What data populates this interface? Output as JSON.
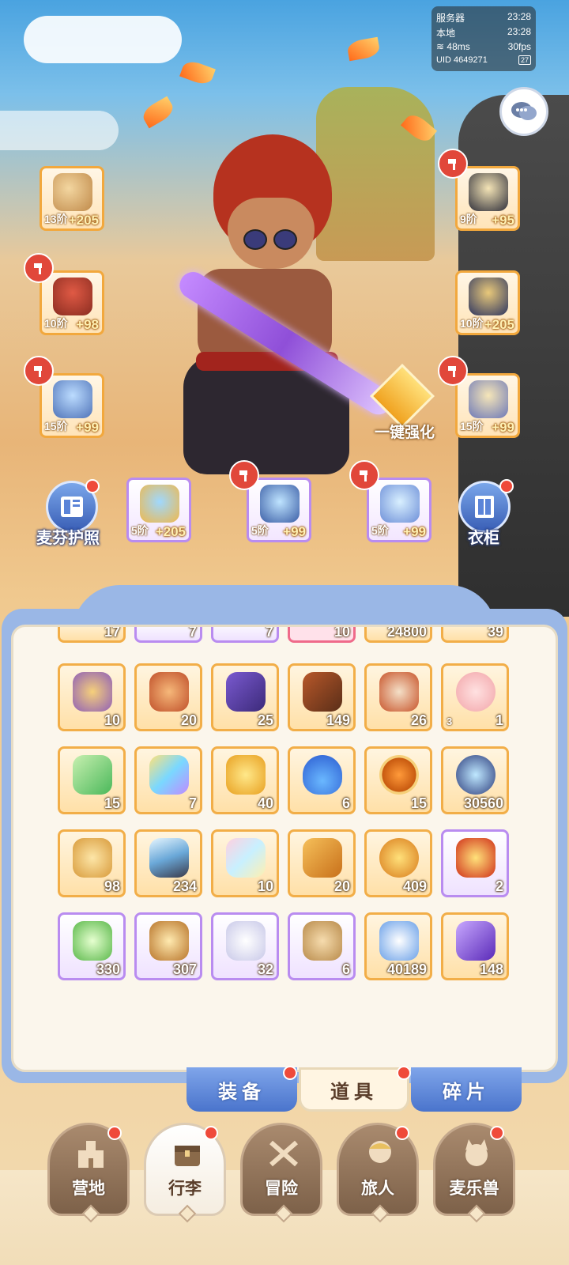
{
  "status": {
    "server_label": "服务器",
    "server_time": "23:28",
    "local_label": "本地",
    "local_time": "23:28",
    "ping": "48ms",
    "fps": "30fps",
    "uid": "UID 4649271",
    "battery": "27"
  },
  "equipment": {
    "left": [
      {
        "level": "13阶",
        "bonus": "+205",
        "icon": "bow-icon"
      },
      {
        "level": "10阶",
        "bonus": "+98",
        "icon": "armor-icon"
      },
      {
        "level": "15阶",
        "bonus": "+99",
        "icon": "pants-icon"
      }
    ],
    "right": [
      {
        "level": "9阶",
        "bonus": "+95",
        "icon": "helmet-icon"
      },
      {
        "level": "10阶",
        "bonus": "+205",
        "icon": "bracer-icon"
      },
      {
        "level": "15阶",
        "bonus": "+99",
        "icon": "boots-icon"
      }
    ],
    "accessories": [
      {
        "level": "5阶",
        "bonus": "+205",
        "icon": "ring-icon"
      },
      {
        "level": "5阶",
        "bonus": "+99",
        "icon": "necklace-icon"
      },
      {
        "level": "5阶",
        "bonus": "+99",
        "icon": "charm-icon"
      }
    ],
    "passport_label": "麦芬护照",
    "wardrobe_label": "衣柜",
    "quick_enhance_label": "一键强化"
  },
  "bag": {
    "partial_row": [
      "17",
      "7",
      "7",
      "10",
      "24800",
      "39"
    ],
    "rows": [
      [
        {
          "qty": "10",
          "icon": "guild-badge-icon"
        },
        {
          "qty": "20",
          "icon": "iron-icon"
        },
        {
          "qty": "25",
          "icon": "purple-ticket-icon"
        },
        {
          "qty": "149",
          "icon": "brown-ticket-icon"
        },
        {
          "qty": "26",
          "icon": "seed-bag-icon"
        },
        {
          "qty": "1",
          "tag": "3",
          "icon": "pig-icon"
        }
      ],
      [
        {
          "qty": "15",
          "icon": "paper-plane-icon"
        },
        {
          "qty": "7",
          "icon": "rainbow-crystal-icon"
        },
        {
          "qty": "40",
          "icon": "star-fish-icon"
        },
        {
          "qty": "6",
          "icon": "blue-potion-icon"
        },
        {
          "qty": "15",
          "icon": "cat-coin-icon"
        },
        {
          "qty": "30560",
          "icon": "crystal-orb-icon"
        }
      ],
      [
        {
          "qty": "98",
          "icon": "lyre-icon"
        },
        {
          "qty": "234",
          "icon": "ice-shard-icon"
        },
        {
          "qty": "10",
          "icon": "paint-tube-icon"
        },
        {
          "qty": "20",
          "icon": "card-icon"
        },
        {
          "qty": "409",
          "icon": "bell-icon"
        },
        {
          "qty": "2",
          "icon": "horseshoe-icon",
          "rarity": "purple"
        }
      ],
      [
        {
          "qty": "330",
          "icon": "bottle-icon",
          "rarity": "purple"
        },
        {
          "qty": "307",
          "icon": "bread-icon",
          "rarity": "purple"
        },
        {
          "qty": "32",
          "icon": "spoon-icon",
          "rarity": "purple"
        },
        {
          "qty": "6",
          "icon": "paw-sack-icon",
          "rarity": "purple"
        },
        {
          "qty": "40189",
          "icon": "star-crystal-icon"
        },
        {
          "qty": "148",
          "icon": "purple-gem-icon"
        }
      ]
    ]
  },
  "tabs": [
    {
      "label": "装备",
      "active": false
    },
    {
      "label": "道具",
      "active": true
    },
    {
      "label": "碎片",
      "active": false
    }
  ],
  "nav": [
    {
      "label": "营地",
      "icon": "castle-icon",
      "active": false
    },
    {
      "label": "行李",
      "icon": "chest-icon",
      "active": true
    },
    {
      "label": "冒险",
      "icon": "crossed-swords-icon",
      "active": false
    },
    {
      "label": "旅人",
      "icon": "traveler-icon",
      "active": false
    },
    {
      "label": "麦乐兽",
      "icon": "pet-icon",
      "active": false
    }
  ],
  "colors": {
    "orange_border": "#f2ae48",
    "purple_border": "#b98cf0",
    "panel_blue": "#9ab7e6",
    "notify_red": "#ef4a3a"
  }
}
